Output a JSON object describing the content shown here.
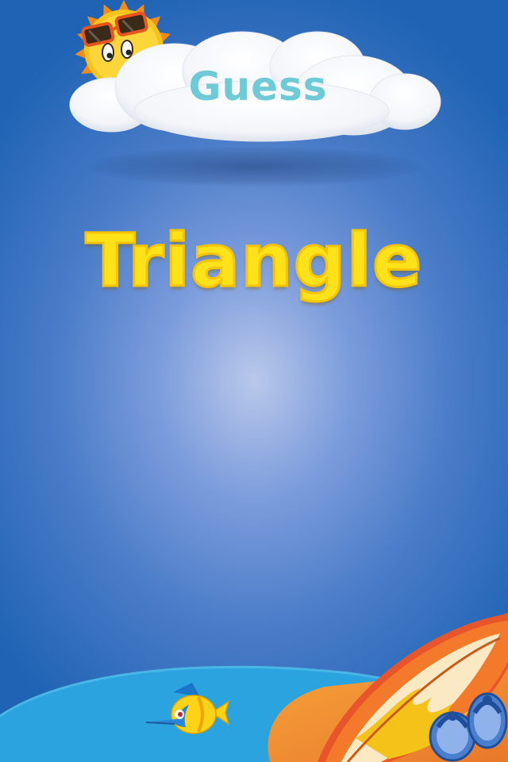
{
  "header": {
    "title": "Guess"
  },
  "main": {
    "word": "Triangle"
  },
  "colors": {
    "background_center": "#b9c8ea",
    "background_edge": "#1f63b4",
    "guess_text": "#6ecad6",
    "word_text": "#ffe21a",
    "sun": "#f8c21c",
    "water": "#2aa3de"
  },
  "icons": {
    "sun": "sun-with-sunglasses-icon",
    "cloud": "cloud-icon",
    "fish": "fish-icon",
    "surfboard": "surfboard-icon",
    "flipflops": "flip-flops-icon"
  }
}
